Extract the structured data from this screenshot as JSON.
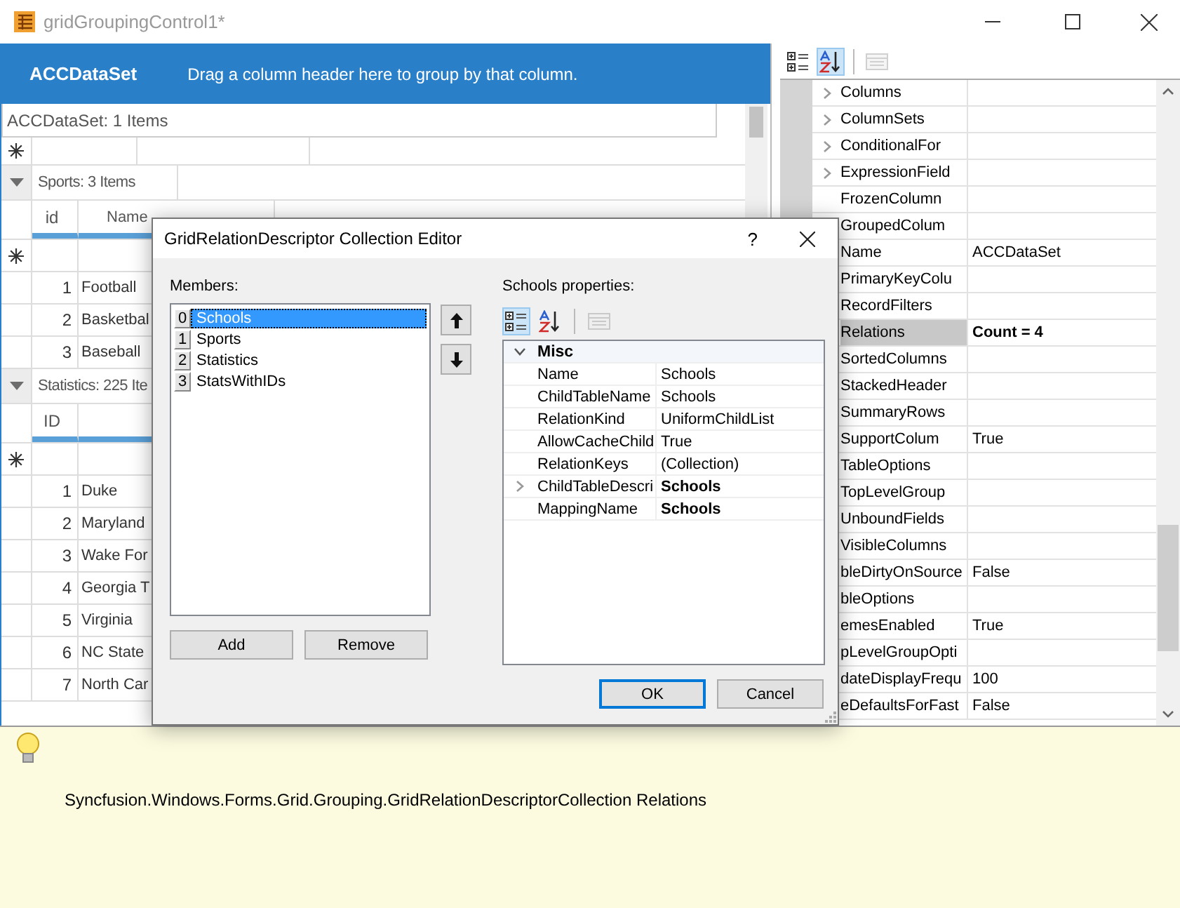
{
  "window": {
    "title": "gridGroupingControl1*"
  },
  "grid": {
    "table_name": "ACCDataSet",
    "group_hint": "Drag a column header here to group by that column.",
    "caption": "ACCDataSet: 1 Items",
    "groups": [
      {
        "label": "Sports: 3 Items",
        "expanded": true,
        "columns": [
          "id",
          "Name"
        ],
        "rows": [
          [
            "1",
            "Football"
          ],
          [
            "2",
            "Basketbal"
          ],
          [
            "3",
            "Baseball"
          ]
        ]
      },
      {
        "label": "Statistics: 225 Ite",
        "expanded": true,
        "columns": [
          "ID"
        ],
        "rows": [
          [
            "1",
            "Duke"
          ],
          [
            "2",
            "Maryland"
          ],
          [
            "3",
            "Wake For"
          ],
          [
            "4",
            "Georgia T"
          ],
          [
            "5",
            "Virginia"
          ],
          [
            "6",
            "NC State"
          ],
          [
            "7",
            "North Car"
          ]
        ]
      }
    ]
  },
  "property_grid": {
    "toolbar": [
      {
        "kind": "categorized",
        "selected": false,
        "disabled": false
      },
      {
        "kind": "alphabetical",
        "selected": true,
        "disabled": false
      },
      {
        "kind": "pages",
        "selected": false,
        "disabled": true
      }
    ],
    "rows": [
      {
        "name": "Columns",
        "expandable": true,
        "selected": false
      },
      {
        "name": "ColumnSets",
        "expandable": true,
        "selected": false
      },
      {
        "name": "ConditionalFor",
        "expandable": true,
        "selected": false
      },
      {
        "name": "ExpressionField",
        "expandable": true,
        "selected": false
      },
      {
        "name": "FrozenColumn",
        "expandable": false,
        "selected": false
      },
      {
        "name": "GroupedColum",
        "selected": false
      },
      {
        "name": "Name",
        "value": "ACCDataSet",
        "selected": false,
        "bold": false
      },
      {
        "name": "PrimaryKeyColu",
        "selected": false
      },
      {
        "name": "RecordFilters",
        "selected": false
      },
      {
        "name": "Relations",
        "value": "Count = 4",
        "selected": true,
        "bold": true
      },
      {
        "name": "SortedColumns",
        "selected": false
      },
      {
        "name": "StackedHeader",
        "selected": false
      },
      {
        "name": "SummaryRows",
        "selected": false
      },
      {
        "name": "SupportColum",
        "value": "True",
        "selected": false,
        "bold": false
      },
      {
        "name": "TableOptions",
        "selected": false
      },
      {
        "name": "TopLevelGroup",
        "selected": false
      },
      {
        "name": "UnboundFields",
        "selected": false
      },
      {
        "name": "VisibleColumns",
        "selected": false
      },
      {
        "name": "bleDirtyOnSource",
        "value": "False",
        "selected": false,
        "bold": false
      },
      {
        "name": "bleOptions",
        "selected": false
      },
      {
        "name": "emesEnabled",
        "value": "True",
        "selected": false,
        "bold": false
      },
      {
        "name": "pLevelGroupOpti",
        "selected": false
      },
      {
        "name": "dateDisplayFrequ",
        "value": "100",
        "selected": false,
        "bold": false
      },
      {
        "name": "eDefaultsForFast",
        "value": "False",
        "selected": false,
        "bold": false
      }
    ]
  },
  "dialog": {
    "title": "GridRelationDescriptor Collection Editor",
    "help": "?",
    "members_label": "Members:",
    "members": [
      {
        "index": "0",
        "name": "Schools",
        "selected": true
      },
      {
        "index": "1",
        "name": "Sports",
        "selected": false
      },
      {
        "index": "2",
        "name": "Statistics",
        "selected": false
      },
      {
        "index": "3",
        "name": "StatsWithIDs",
        "selected": false
      }
    ],
    "properties_label": "Schools properties:",
    "toolbar": [
      {
        "kind": "categorized",
        "selected": true,
        "disabled": false
      },
      {
        "kind": "alphabetical",
        "selected": false,
        "disabled": false
      },
      {
        "kind": "pages",
        "selected": false,
        "disabled": true
      }
    ],
    "category": {
      "name": "Misc",
      "expanded": true
    },
    "properties": [
      {
        "name": "Name",
        "value": "Schools",
        "bold": false,
        "expandable": false
      },
      {
        "name": "ChildTableName",
        "value": "Schools",
        "bold": false,
        "expandable": false
      },
      {
        "name": "RelationKind",
        "value": "UniformChildList",
        "bold": false,
        "expandable": false
      },
      {
        "name": "AllowCacheChild",
        "value": "True",
        "bold": false,
        "expandable": false
      },
      {
        "name": "RelationKeys",
        "value": "(Collection)",
        "bold": false,
        "expandable": false
      },
      {
        "name": "ChildTableDescri",
        "value": "Schools",
        "bold": true,
        "expandable": true
      },
      {
        "name": "MappingName",
        "value": "Schools",
        "bold": true,
        "expandable": false
      }
    ],
    "add_button": "Add",
    "remove_button": "Remove",
    "buttons": [
      {
        "label": "OK",
        "default": true
      },
      {
        "label": "Cancel",
        "default": false
      }
    ]
  },
  "description": {
    "text": "Syncfusion.Windows.Forms.Grid.Grouping.GridRelationDescriptorCollection Relations"
  }
}
